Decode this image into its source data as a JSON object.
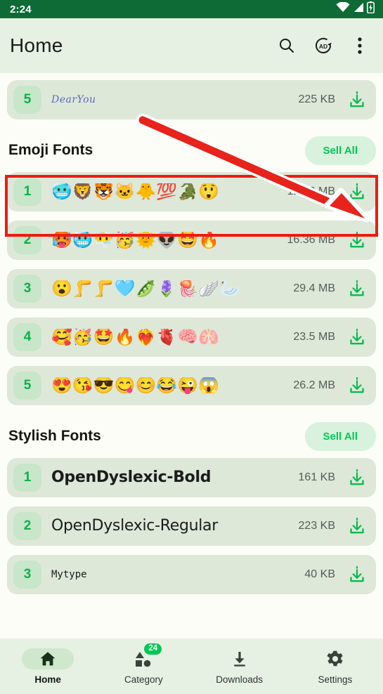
{
  "status_bar": {
    "time": "2:24",
    "icons": [
      "wifi-icon",
      "signal-icon",
      "battery-icon"
    ]
  },
  "app_bar": {
    "title": "Home",
    "actions": [
      {
        "name": "search-icon",
        "label": "Search"
      },
      {
        "name": "ad-icon",
        "label": "AD"
      },
      {
        "name": "overflow-menu-icon",
        "label": "More options"
      }
    ]
  },
  "partial_row_top": {
    "rank": "5",
    "preview": "DearYou",
    "size": "225 KB",
    "action": "download-icon"
  },
  "sections": [
    {
      "title": "Emoji Fonts",
      "see_all_label": "Sell All",
      "rows": [
        {
          "rank": "1",
          "preview": "🥶🦁🐯🐱🐥💯🐊😲",
          "size": "12.92 MB",
          "action": "download-icon"
        },
        {
          "rank": "2",
          "preview": "🥵🥶😶‍🌫️🥳🌞👽🤩🔥",
          "size": "16.36 MB",
          "action": "download-icon"
        },
        {
          "rank": "3",
          "preview": "😮🦵🦵🩵🫛🪻🪼🪽🦢",
          "size": "29.4 MB",
          "action": "download-icon"
        },
        {
          "rank": "4",
          "preview": "🥰🥳🤩🔥❤️‍🔥🫀🧠🫁",
          "size": "23.5 MB",
          "action": "download-icon"
        },
        {
          "rank": "5",
          "preview": "😍😘😎😋😊😂😜😱",
          "size": "26.2 MB",
          "action": "download-icon"
        }
      ]
    },
    {
      "title": "Stylish Fonts",
      "see_all_label": "Sell All",
      "rows": [
        {
          "rank": "1",
          "preview": "OpenDyslexic-Bold",
          "size": "161 KB",
          "action": "download-icon"
        },
        {
          "rank": "2",
          "preview": "OpenDyslexic-Regular",
          "size": "223 KB",
          "action": "download-icon"
        },
        {
          "rank": "3",
          "preview": "Mytype",
          "size": "40 KB",
          "action": "download-icon"
        }
      ]
    }
  ],
  "bottom_nav": {
    "items": [
      {
        "label": "Home",
        "icon": "home-icon",
        "active": true,
        "badge": ""
      },
      {
        "label": "Category",
        "icon": "category-icon",
        "active": false,
        "badge": "24"
      },
      {
        "label": "Downloads",
        "icon": "download-icon",
        "active": false,
        "badge": ""
      },
      {
        "label": "Settings",
        "icon": "gear-icon",
        "active": false,
        "badge": ""
      }
    ]
  },
  "annotation": {
    "highlight_color": "#ee1b11",
    "arrow_color": "#e8231b",
    "target": "download-icon of Emoji Fonts row 1"
  },
  "colors": {
    "status_bar": "#0e6b36",
    "app_bar": "#e6f0e3",
    "page_bg": "#fbfdf6",
    "row_bg": "#dde8d9",
    "rank_bg": "#c8e6c9",
    "accent_green": "#00c853"
  }
}
